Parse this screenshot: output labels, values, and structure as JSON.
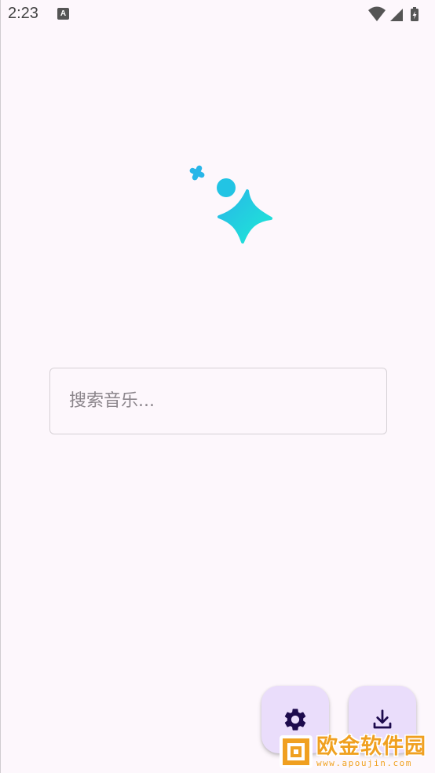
{
  "status_bar": {
    "time": "2:23",
    "notification_icon": "A",
    "icons": [
      "wifi-icon",
      "signal-icon",
      "battery-charging-icon"
    ]
  },
  "logo": {
    "icon": "sparkle-logo-icon",
    "gradient": [
      "#29b6e8",
      "#1de9d6"
    ]
  },
  "search": {
    "placeholder": "搜索音乐...",
    "value": ""
  },
  "fabs": [
    {
      "icon": "gear-icon",
      "color": "#1d0a4d"
    },
    {
      "icon": "download-icon",
      "color": "#1d0a4d"
    }
  ],
  "colors": {
    "background": "#fdf7fc",
    "fab_background": "#eaddfb",
    "watermark": "#f0a020"
  },
  "watermark": {
    "title": "欧金软件园",
    "url": "www.apoujin.com"
  }
}
